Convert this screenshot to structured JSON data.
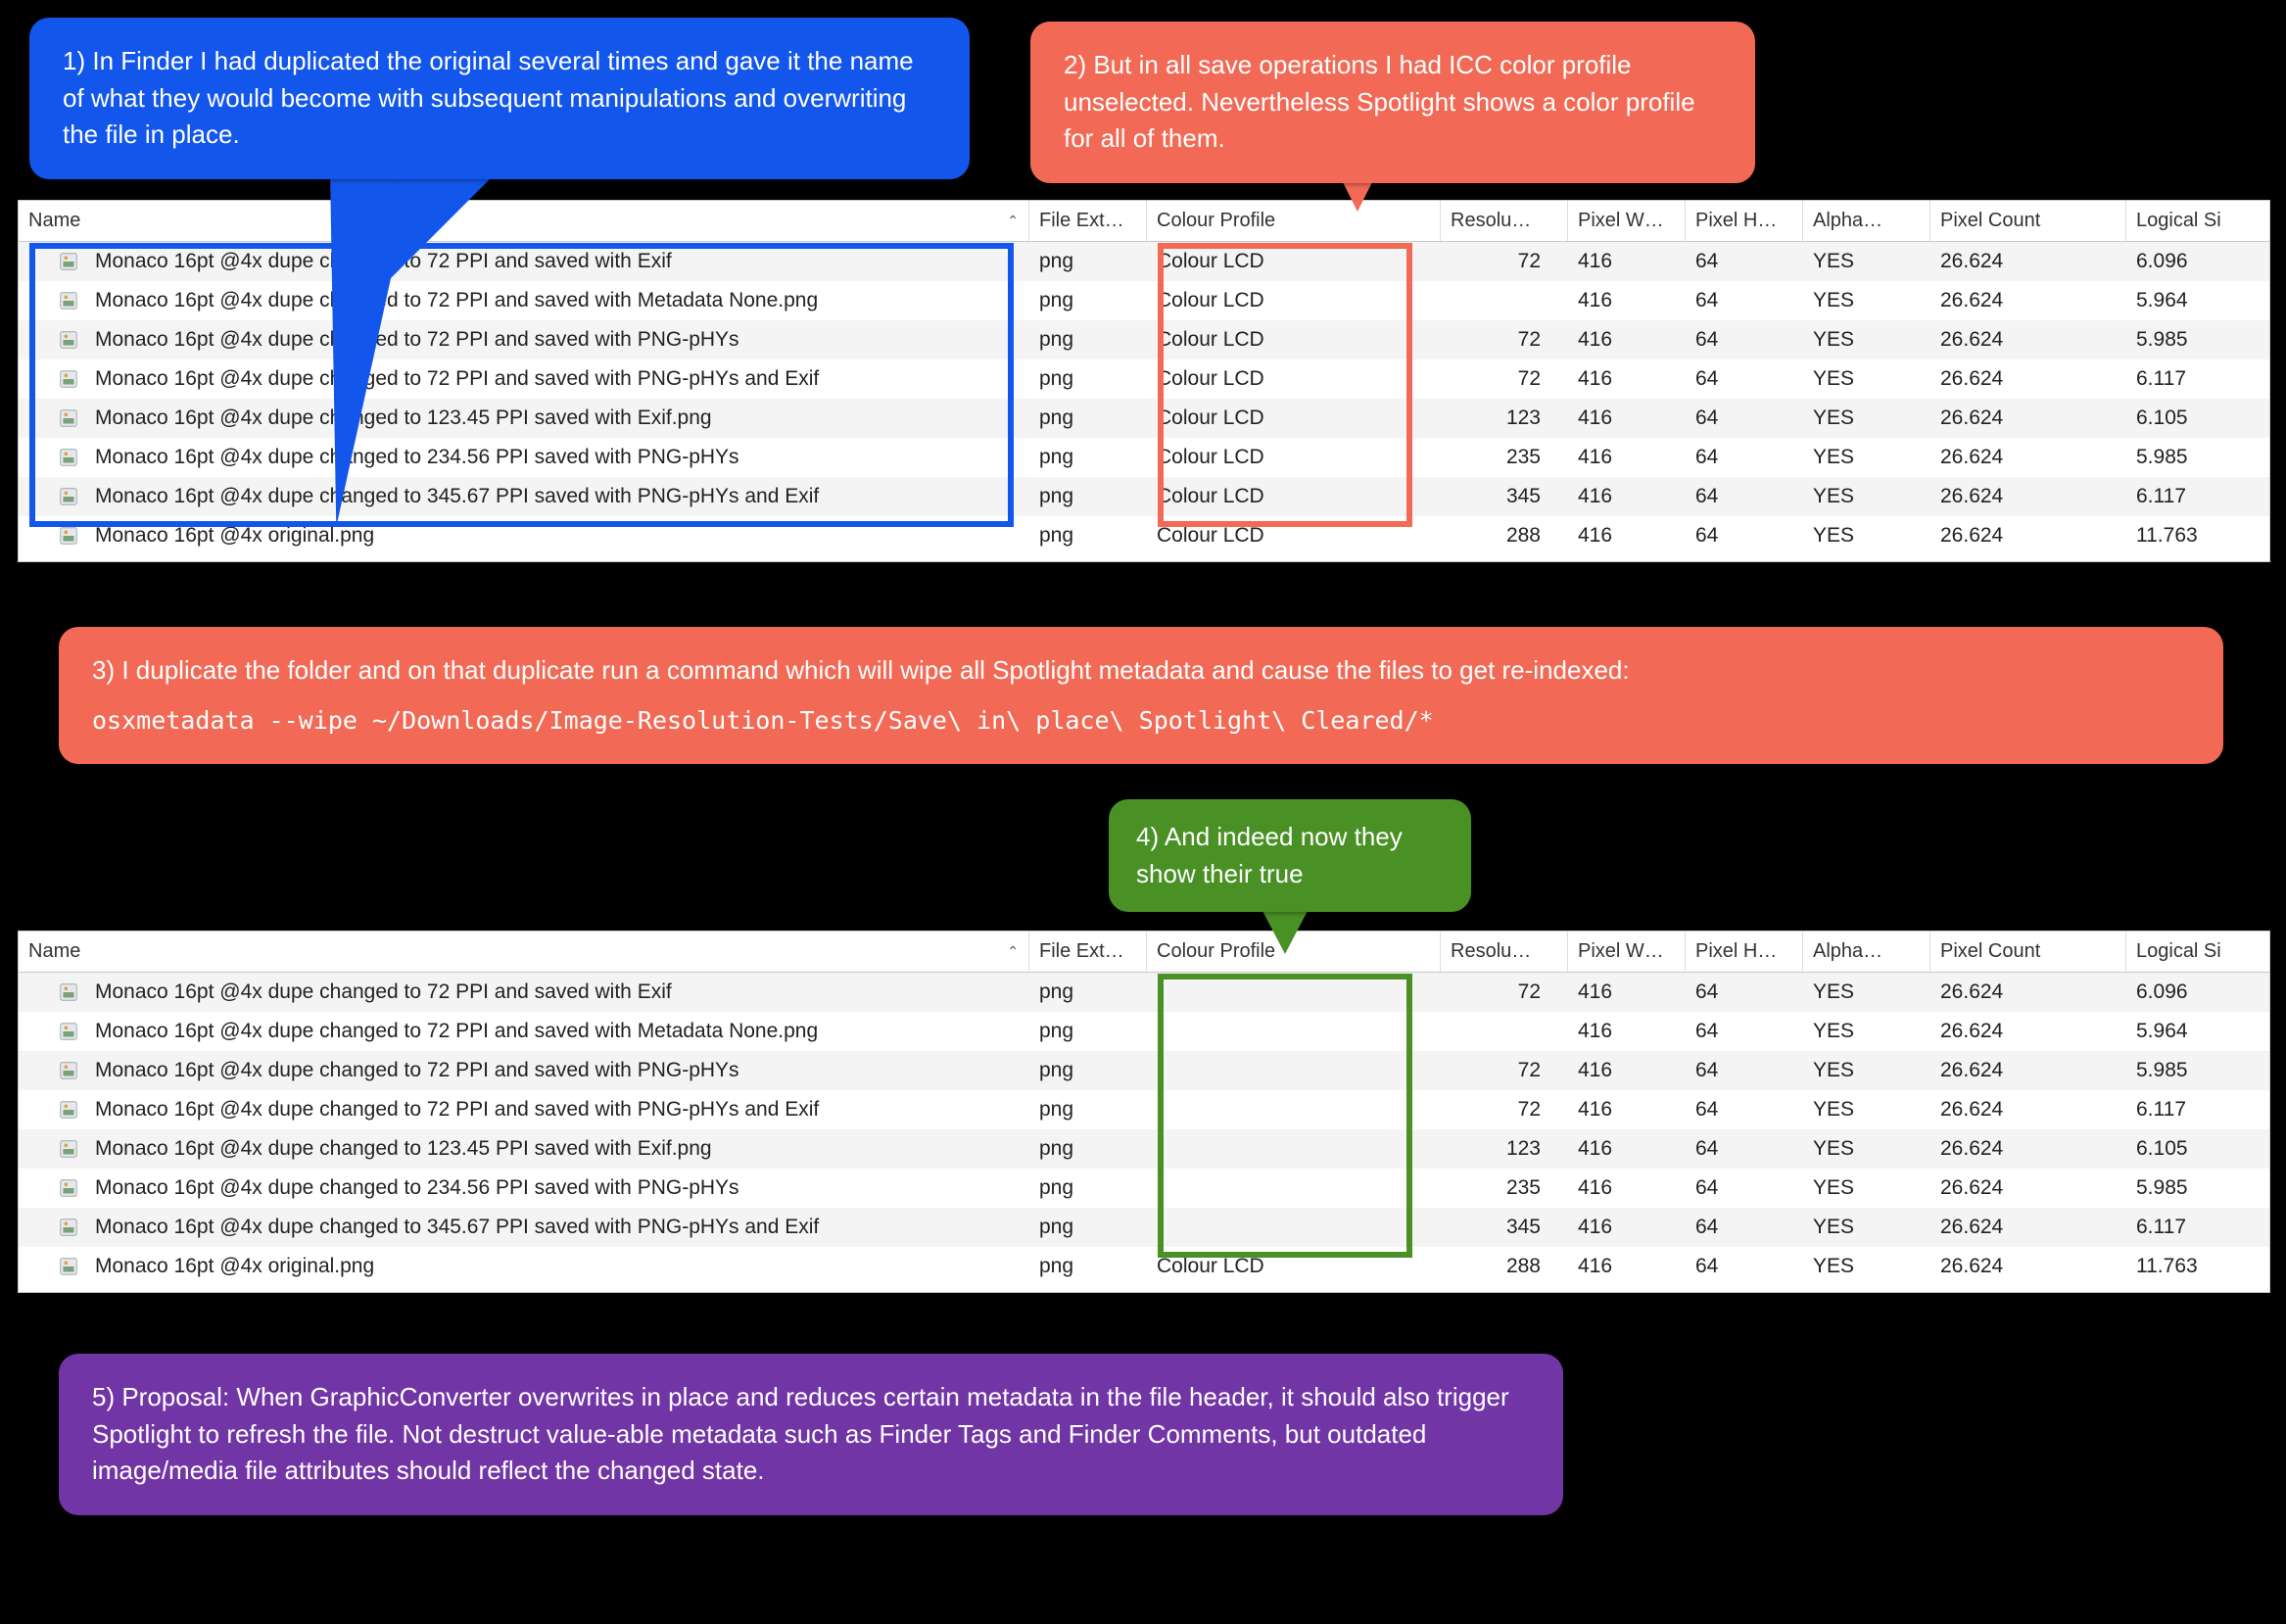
{
  "columns": {
    "name": "Name",
    "ext": "File Ext…",
    "prof": "Colour Profile",
    "res": "Resolu…",
    "pw": "Pixel W…",
    "ph": "Pixel H…",
    "alpha": "Alpha…",
    "pcount": "Pixel Count",
    "logsz": "Logical Si"
  },
  "rows_top": [
    {
      "name": "Monaco 16pt @4x dupe changed to 72 PPI and saved with Exif",
      "ext": "png",
      "prof": "Colour LCD",
      "res": "72",
      "pw": "416",
      "ph": "64",
      "alpha": "YES",
      "pcount": "26.624",
      "logsz": "6.096"
    },
    {
      "name": "Monaco 16pt @4x dupe changed to 72 PPI and saved with Metadata None.png",
      "ext": "png",
      "prof": "Colour LCD",
      "res": "",
      "pw": "416",
      "ph": "64",
      "alpha": "YES",
      "pcount": "26.624",
      "logsz": "5.964"
    },
    {
      "name": "Monaco 16pt @4x dupe changed to 72 PPI and saved with PNG-pHYs",
      "ext": "png",
      "prof": "Colour LCD",
      "res": "72",
      "pw": "416",
      "ph": "64",
      "alpha": "YES",
      "pcount": "26.624",
      "logsz": "5.985"
    },
    {
      "name": "Monaco 16pt @4x dupe changed to 72 PPI and saved with PNG-pHYs and Exif",
      "ext": "png",
      "prof": "Colour LCD",
      "res": "72",
      "pw": "416",
      "ph": "64",
      "alpha": "YES",
      "pcount": "26.624",
      "logsz": "6.117"
    },
    {
      "name": "Monaco 16pt @4x dupe changed to 123.45 PPI saved with Exif.png",
      "ext": "png",
      "prof": "Colour LCD",
      "res": "123",
      "pw": "416",
      "ph": "64",
      "alpha": "YES",
      "pcount": "26.624",
      "logsz": "6.105"
    },
    {
      "name": "Monaco 16pt @4x dupe changed to 234.56 PPI saved with PNG-pHYs",
      "ext": "png",
      "prof": "Colour LCD",
      "res": "235",
      "pw": "416",
      "ph": "64",
      "alpha": "YES",
      "pcount": "26.624",
      "logsz": "5.985"
    },
    {
      "name": "Monaco 16pt @4x dupe changed to 345.67 PPI saved with PNG-pHYs and Exif",
      "ext": "png",
      "prof": "Colour LCD",
      "res": "345",
      "pw": "416",
      "ph": "64",
      "alpha": "YES",
      "pcount": "26.624",
      "logsz": "6.117"
    },
    {
      "name": "Monaco 16pt @4x original.png",
      "ext": "png",
      "prof": "Colour LCD",
      "res": "288",
      "pw": "416",
      "ph": "64",
      "alpha": "YES",
      "pcount": "26.624",
      "logsz": "11.763"
    }
  ],
  "rows_bottom": [
    {
      "name": "Monaco 16pt @4x dupe changed to 72 PPI and saved with Exif",
      "ext": "png",
      "prof": "",
      "res": "72",
      "pw": "416",
      "ph": "64",
      "alpha": "YES",
      "pcount": "26.624",
      "logsz": "6.096"
    },
    {
      "name": "Monaco 16pt @4x dupe changed to 72 PPI and saved with Metadata None.png",
      "ext": "png",
      "prof": "",
      "res": "",
      "pw": "416",
      "ph": "64",
      "alpha": "YES",
      "pcount": "26.624",
      "logsz": "5.964"
    },
    {
      "name": "Monaco 16pt @4x dupe changed to 72 PPI and saved with PNG-pHYs",
      "ext": "png",
      "prof": "",
      "res": "72",
      "pw": "416",
      "ph": "64",
      "alpha": "YES",
      "pcount": "26.624",
      "logsz": "5.985"
    },
    {
      "name": "Monaco 16pt @4x dupe changed to 72 PPI and saved with PNG-pHYs and Exif",
      "ext": "png",
      "prof": "",
      "res": "72",
      "pw": "416",
      "ph": "64",
      "alpha": "YES",
      "pcount": "26.624",
      "logsz": "6.117"
    },
    {
      "name": "Monaco 16pt @4x dupe changed to 123.45 PPI saved with Exif.png",
      "ext": "png",
      "prof": "",
      "res": "123",
      "pw": "416",
      "ph": "64",
      "alpha": "YES",
      "pcount": "26.624",
      "logsz": "6.105"
    },
    {
      "name": "Monaco 16pt @4x dupe changed to 234.56 PPI saved with PNG-pHYs",
      "ext": "png",
      "prof": "",
      "res": "235",
      "pw": "416",
      "ph": "64",
      "alpha": "YES",
      "pcount": "26.624",
      "logsz": "5.985"
    },
    {
      "name": "Monaco 16pt @4x dupe changed to 345.67 PPI saved with PNG-pHYs and Exif",
      "ext": "png",
      "prof": "",
      "res": "345",
      "pw": "416",
      "ph": "64",
      "alpha": "YES",
      "pcount": "26.624",
      "logsz": "6.117"
    },
    {
      "name": "Monaco 16pt @4x original.png",
      "ext": "png",
      "prof": "Colour LCD",
      "res": "288",
      "pw": "416",
      "ph": "64",
      "alpha": "YES",
      "pcount": "26.624",
      "logsz": "11.763"
    }
  ],
  "callouts": {
    "c1": "1) In Finder I had duplicated the original several times and gave it the name of what they would become with subsequent manipulations and overwriting the file in place.",
    "c2": "2) But in all save operations I had ICC color profile unselected. Nevertheless Spotlight shows a color profile for all of them.",
    "c3_text": "3) I duplicate the folder and on that duplicate run a command which will wipe all Spotlight metadata and cause the files to get re-indexed:",
    "c3_cmd": "osxmetadata --wipe ~/Downloads/Image-Resolution-Tests/Save\\ in\\ place\\ Spotlight\\ Cleared/*",
    "c4": "4) And indeed now they show their true",
    "c5": "5) Proposal: When GraphicConverter overwrites in place and reduces certain metadata in the file header, it should also trigger Spotlight to refresh the file. Not destruct value-able metadata such as Finder Tags and Finder Comments, but outdated image/media file attributes should reflect the changed state."
  }
}
